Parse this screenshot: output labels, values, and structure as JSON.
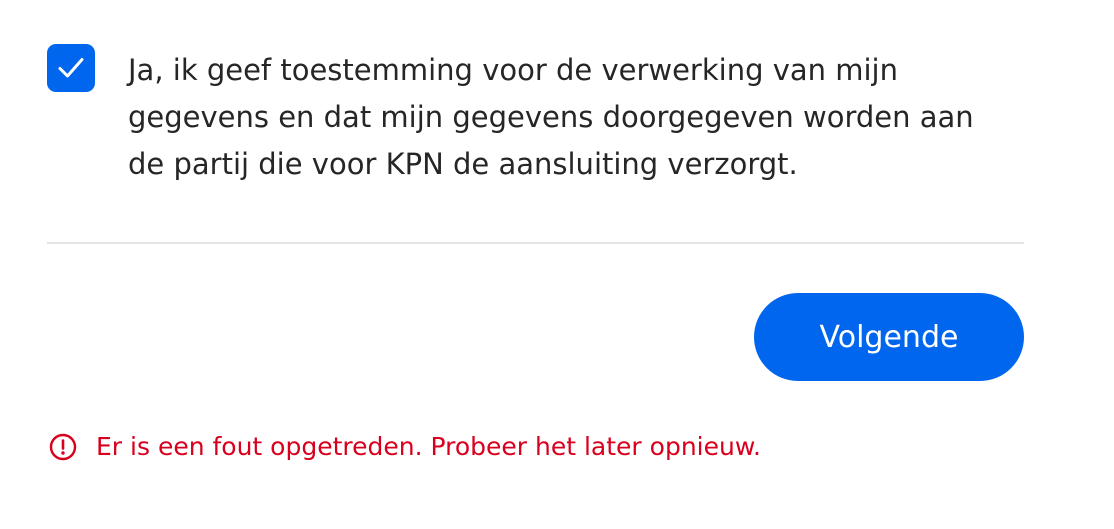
{
  "consent": {
    "checked": true,
    "label": "Ja, ik geef toestemming voor de verwerking van mijn gegevens en dat mijn gegevens doorgegeven worden aan de partij die voor KPN de aansluiting verzorgt."
  },
  "actions": {
    "next_label": "Volgende"
  },
  "error": {
    "icon": "alert-circle-icon",
    "message": "Er is een fout opgetreden. Probeer het later opnieuw."
  },
  "colors": {
    "accent": "#0066EE",
    "error": "#D9001E",
    "text": "#262626",
    "divider": "#E4E4E4"
  }
}
